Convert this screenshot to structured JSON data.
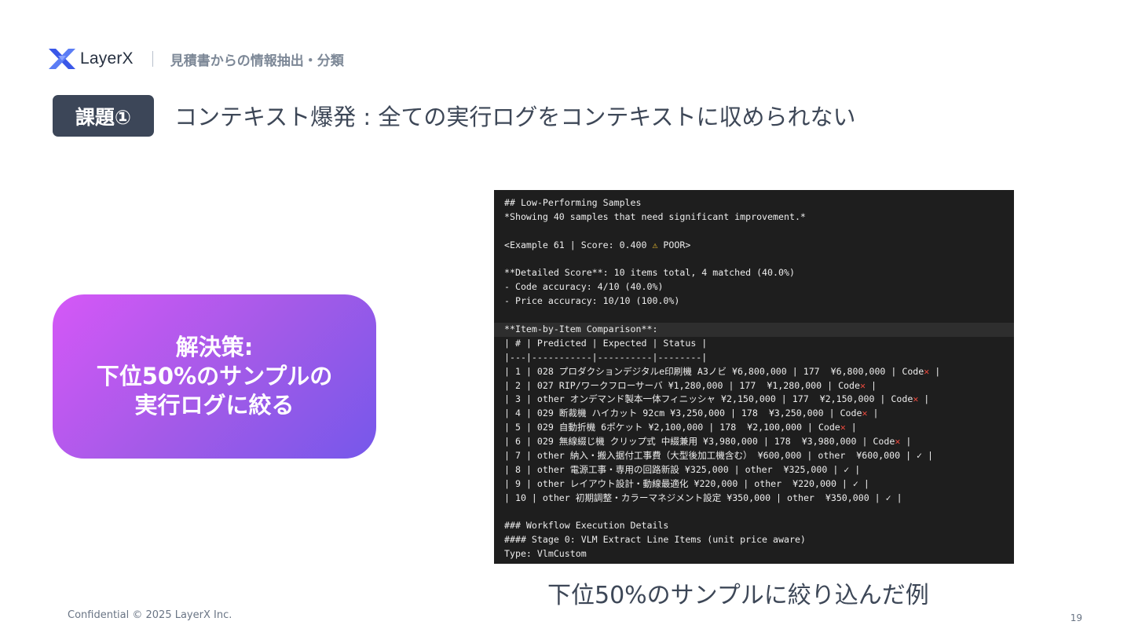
{
  "header": {
    "logo_text": "LayerX",
    "section_title": "見積書からの情報抽出・分類"
  },
  "issue": {
    "badge": "課題①",
    "headline": "コンテキスト爆発 : 全ての実行ログをコンテキストに収められない"
  },
  "solution": {
    "lines": [
      "解決策:",
      "下位50%のサンプルの",
      "実行ログに絞る"
    ]
  },
  "terminal": {
    "heading": "## Low-Performing Samples",
    "subheading": "*Showing 40 samples that need significant improvement.*",
    "example_prefix": "<Example 61 | Score: 0.400 ",
    "example_warn": "⚠",
    "example_suffix": " POOR>",
    "score_summary": "**Detailed Score**: 10 items total, 4 matched (40.0%)",
    "code_accuracy": "- Code accuracy: 4/10 (40.0%)",
    "price_accuracy": "- Price accuracy: 10/10 (100.0%)",
    "comparison_title": "**Item-by-Item Comparison**:",
    "table_header": "| # | Predicted | Expected | Status |",
    "table_sep": "|---|-----------|----------|--------|",
    "rows": [
      {
        "text": "| 1 | 028 プロダクションデジタルe印刷機 A3ノビ ¥6,800,000 | 177  ¥6,800,000 | Code",
        "mark": "✕",
        "tail": " |"
      },
      {
        "text": "| 2 | 027 RIP/ワークフローサーバ ¥1,280,000 | 177  ¥1,280,000 | Code",
        "mark": "✕",
        "tail": " |"
      },
      {
        "text": "| 3 | other オンデマンド製本一体フィニッシャ ¥2,150,000 | 177  ¥2,150,000 | Code",
        "mark": "✕",
        "tail": " |"
      },
      {
        "text": "| 4 | 029 断裁機 ハイカット 92cm ¥3,250,000 | 178  ¥3,250,000 | Code",
        "mark": "✕",
        "tail": " |"
      },
      {
        "text": "| 5 | 029 自動折機 6ポケット ¥2,100,000 | 178  ¥2,100,000 | Code",
        "mark": "✕",
        "tail": " |"
      },
      {
        "text": "| 6 | 029 無線綴じ機 クリップ式 中綴兼用 ¥3,980,000 | 178  ¥3,980,000 | Code",
        "mark": "✕",
        "tail": " |"
      },
      {
        "text": "| 7 | other 納入・搬入据付工事費（大型後加工機含む） ¥600,000 | other  ¥600,000 | ✓ |",
        "mark": "",
        "tail": ""
      },
      {
        "text": "| 8 | other 電源工事・専用の回路新設 ¥325,000 | other  ¥325,000 | ✓ |",
        "mark": "",
        "tail": ""
      },
      {
        "text": "| 9 | other レイアウト設計・動線最適化 ¥220,000 | other  ¥220,000 | ✓ |",
        "mark": "",
        "tail": ""
      },
      {
        "text": "| 10 | other 初期調整・カラーマネジメント設定 ¥350,000 | other  ¥350,000 | ✓ |",
        "mark": "",
        "tail": ""
      }
    ],
    "workflow_title": "### Workflow Execution Details",
    "stage_title": "#### Stage 0: VLM Extract Line Items (unit price aware)",
    "type_line": "Type: VlmCustom"
  },
  "caption": "下位50%のサンプルに絞り込んだ例",
  "footer": {
    "confidential": "Confidential © 2025 LayerX Inc.",
    "page_number": "19"
  },
  "colors": {
    "badge_bg": "#3c4658",
    "gradient_start": "#d558f7",
    "gradient_end": "#7658ea",
    "terminal_bg": "#1e1e1e",
    "error_mark": "#f04a3e"
  }
}
